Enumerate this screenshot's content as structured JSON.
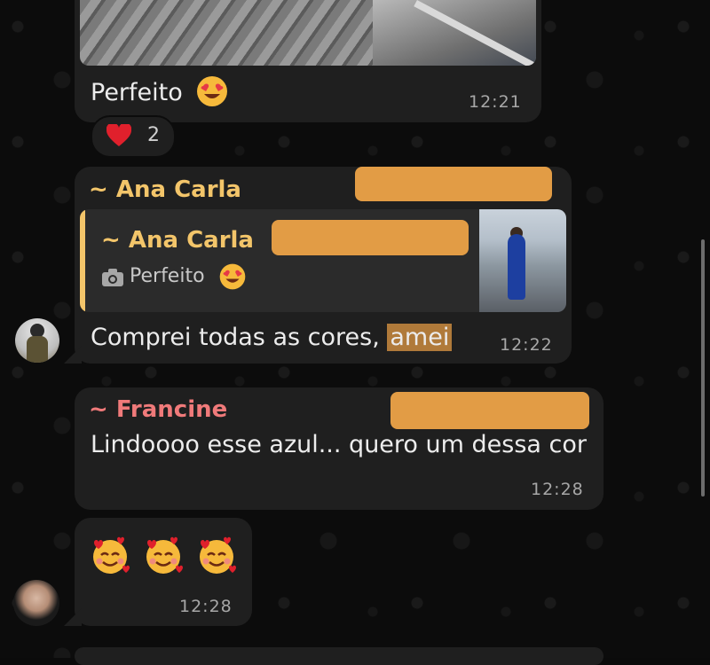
{
  "colors": {
    "bubble": "#1f1f1f",
    "quote_bg": "#2b2b2b",
    "ana_carla": "#f3c56a",
    "francine": "#f07a7a",
    "redaction": "#e29c45",
    "timestamp": "#a7a7a7"
  },
  "messages": [
    {
      "type": "image-with-caption",
      "caption": "Perfeito",
      "caption_emoji": "heart-eyes-emoji",
      "time": "12:21",
      "reaction": {
        "emoji": "heart",
        "count": "2"
      }
    },
    {
      "type": "reply",
      "sender": "~ Ana Carla",
      "quoted": {
        "sender": "~ Ana Carla",
        "icon": "camera-icon",
        "text": "Perfeito",
        "emoji": "heart-eyes-emoji"
      },
      "text_before": "Comprei todas as cores, ",
      "text_highlight": "amei",
      "time": "12:22"
    },
    {
      "type": "text",
      "sender": "~ Francine",
      "text": "Lindoooo esse azul... quero um dessa cor",
      "time": "12:28"
    },
    {
      "type": "emoji-only",
      "emojis": [
        "smiling-face-with-hearts",
        "smiling-face-with-hearts",
        "smiling-face-with-hearts"
      ],
      "time": "12:28"
    }
  ]
}
